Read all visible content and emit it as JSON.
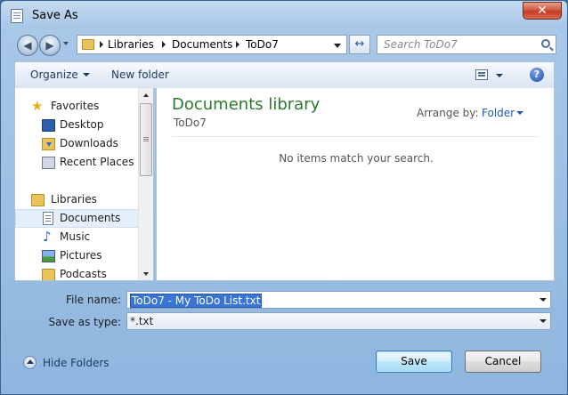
{
  "window": {
    "title": "Save As",
    "close_glyph": "✕",
    "app_icon": "document-icon"
  },
  "nav": {
    "back_glyph": "◀",
    "forward_glyph": "▶",
    "refresh_glyph": "↔"
  },
  "address": {
    "crumbs": [
      "Libraries",
      "Documents",
      "ToDo7"
    ]
  },
  "search": {
    "placeholder": "Search ToDo7"
  },
  "toolbar": {
    "organize": "Organize",
    "new_folder": "New folder",
    "help_glyph": "?"
  },
  "sidebar": {
    "items": [
      {
        "label": "Favorites",
        "icon": "star-icon"
      },
      {
        "label": "Desktop",
        "icon": "desktop-icon"
      },
      {
        "label": "Downloads",
        "icon": "downloads-icon"
      },
      {
        "label": "Recent Places",
        "icon": "recent-places-icon"
      },
      {
        "label": "Libraries",
        "icon": "libraries-icon"
      },
      {
        "label": "Documents",
        "icon": "documents-icon",
        "selected": true
      },
      {
        "label": "Music",
        "icon": "music-icon"
      },
      {
        "label": "Pictures",
        "icon": "pictures-icon"
      },
      {
        "label": "Podcasts",
        "icon": "podcasts-icon"
      }
    ]
  },
  "content": {
    "library_title": "Documents library",
    "library_subtitle": "ToDo7",
    "arrange_label": "Arrange by:",
    "arrange_value": "Folder",
    "empty_message": "No items match your search."
  },
  "form": {
    "filename_label": "File name:",
    "filename_value": "ToDo7 - My ToDo List.txt",
    "type_label": "Save as type:",
    "type_value": "*.txt"
  },
  "footer": {
    "hide_folders": "Hide Folders",
    "save": "Save",
    "cancel": "Cancel"
  },
  "colors": {
    "library_title": "#2a7a2a",
    "link": "#1e5aa8",
    "selection": "#3875d7"
  }
}
